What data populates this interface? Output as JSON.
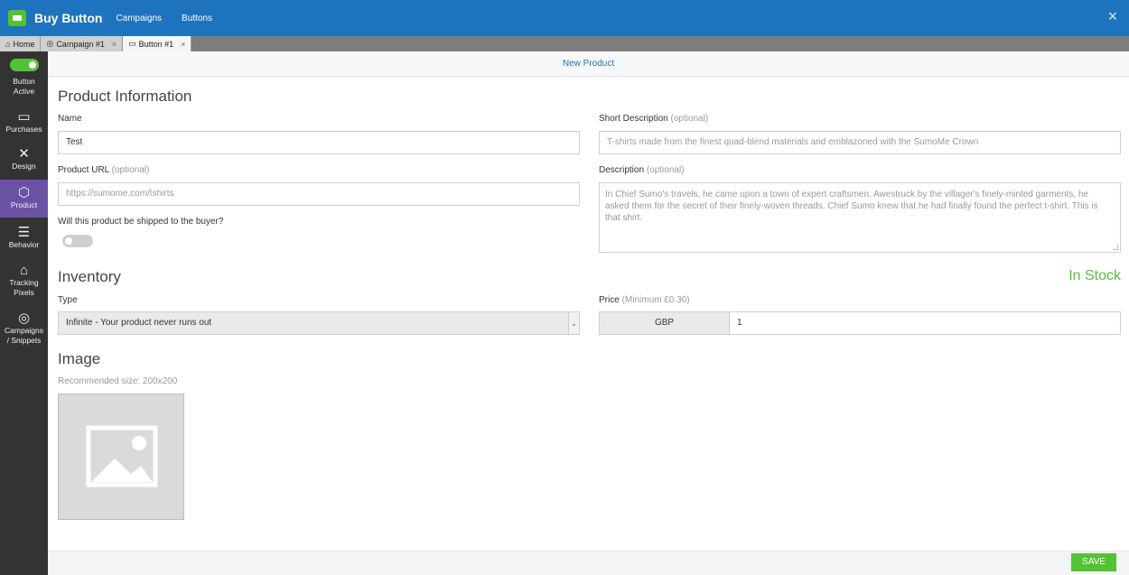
{
  "header": {
    "title": "Buy Button",
    "nav": [
      "Campaigns",
      "Buttons"
    ],
    "close_icon": "×"
  },
  "tabs": [
    {
      "label": "Home",
      "icon": "home-icon",
      "closable": false
    },
    {
      "label": "Campaign #1",
      "icon": "target-icon",
      "closable": true
    },
    {
      "label": "Button #1",
      "icon": "button-icon",
      "closable": true,
      "active": true
    }
  ],
  "sidebar": {
    "toggle_label_line1": "Button",
    "toggle_label_line2": "Active",
    "items": [
      {
        "label": "Purchases",
        "icon": "money-icon"
      },
      {
        "label": "Design",
        "icon": "design-tools-icon"
      },
      {
        "label": "Product",
        "icon": "box-icon",
        "active": true
      },
      {
        "label": "Behavior",
        "icon": "sliders-icon"
      },
      {
        "label_line1": "Tracking",
        "label_line2": "Pixels",
        "icon": "ghost-icon"
      },
      {
        "label_line1": "Campaigns",
        "label_line2": "/ Snippets",
        "icon": "target-icon"
      }
    ]
  },
  "main": {
    "title_bar": "New Product",
    "product_info": {
      "heading": "Product Information",
      "name_label": "Name",
      "name_value": "Test",
      "url_label": "Product URL",
      "optional": "(optional)",
      "url_placeholder": "https://sumome.com/tshirts",
      "shipped_question": "Will this product be shipped to the buyer?",
      "short_desc_label": "Short Description",
      "short_desc_placeholder": "T-shirts made from the finest quad-blend materials and emblazoned with the SumoMe Crown",
      "desc_label": "Description",
      "desc_placeholder": "In Chief Sumo's travels, he came upon a town of expert craftsmen. Awestruck by the villager's finely-minted garments, he asked them for the secret of their finely-woven threads. Chief Sumo knew that he had finally found the perfect t-shirt. This is that shirt."
    },
    "inventory": {
      "heading": "Inventory",
      "status": "In Stock",
      "type_label": "Type",
      "type_value": "Infinite - Your product never runs out",
      "price_label": "Price",
      "price_min": "(Minimum £0.30)",
      "currency": "GBP",
      "price_value": "1"
    },
    "image": {
      "heading": "Image",
      "recommended": "Recommended size: 200x200"
    },
    "save_label": "SAVE"
  }
}
